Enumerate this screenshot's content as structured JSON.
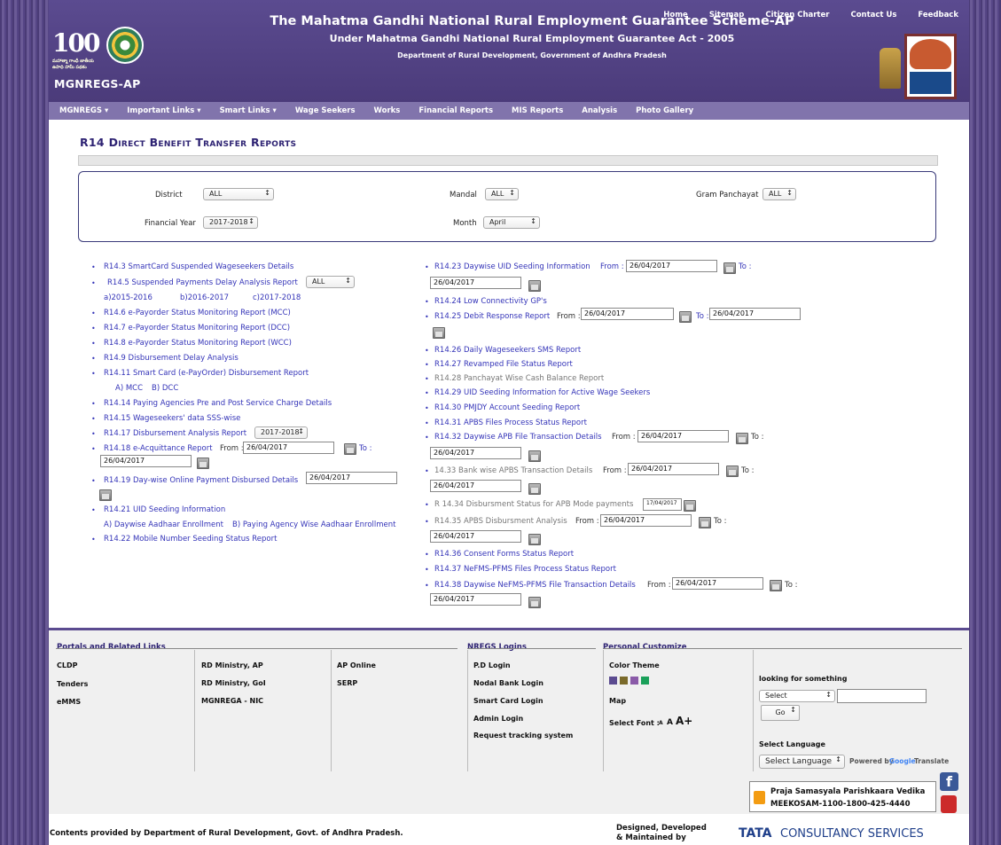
{
  "header": {
    "top_links": [
      "Home",
      "Sitemap",
      "Citizen Charter",
      "Contact Us",
      "Feedback"
    ],
    "logo_text": "100",
    "logo_subtext": "మహాత్మా గాంధీ జాతీయ ఉపాధి హామీ పథకం",
    "brand": "MGNREGS-AP",
    "title1": "The Mahatma Gandhi National Rural Employment Guarantee Scheme-AP",
    "title2": "Under Mahatma Gandhi National Rural Employment Guarantee Act - 2005",
    "title3": "Department of Rural Development, Government of Andhra Pradesh"
  },
  "nav": [
    "MGNREGS ▾",
    "Important Links ▾",
    "Smart Links ▾",
    "Wage Seekers",
    "Works",
    "Financial Reports",
    "MIS Reports",
    "Analysis",
    "Photo Gallery"
  ],
  "page": {
    "title": "R14 Direct Benefit Transfer Reports"
  },
  "filters": {
    "district_label": "District",
    "district_value": "ALL",
    "mandal_label": "Mandal",
    "mandal_value": "ALL",
    "gp_label": "Gram Panchayat",
    "gp_value": "ALL",
    "fy_label": "Financial Year",
    "fy_value": "2017-2018",
    "month_label": "Month",
    "month_value": "April"
  },
  "left": {
    "r143": "R14.3 SmartCard Suspended Wageseekers Details",
    "r145": "R14.5 Suspended Payments Delay Analysis Report",
    "r145_sel": "ALL",
    "r145_a": "a)2015-2016",
    "r145_b": "b)2016-2017",
    "r145_c": "c)2017-2018",
    "r146": "R14.6 e-Payorder Status Monitoring Report (MCC)",
    "r147": "R14.7 e-Payorder Status Monitoring Report (DCC)",
    "r148": "R14.8 e-Payorder Status Monitoring Report (WCC)",
    "r149": "R14.9 Disbursement Delay Analysis",
    "r1411": "R14.11 Smart Card (e-PayOrder) Disbursement Report",
    "r1411_a": "A) MCC",
    "r1411_b": "B) DCC",
    "r1414": "R14.14 Paying Agencies Pre and Post Service Charge Details",
    "r1415": "R14.15 Wageseekers' data SSS-wise",
    "r1417": "R14.17 Disbursement Analysis Report",
    "r1417_sel": "2017-2018",
    "r1418": "R14.18 e-Acquittance Report",
    "r1419": "R14.19 Day-wise Online Payment Disbursed Details",
    "r1421": "R14.21 UID Seeding Information",
    "r1421_a": "A) Daywise Aadhaar Enrollment",
    "r1421_b": "B) Paying Agency Wise Aadhaar Enrollment",
    "r1422": "R14.22 Mobile Number Seeding Status Report"
  },
  "right": {
    "r1423": "R14.23 Daywise UID Seeding Information",
    "r1424": "R14.24 Low Connectivity GP's",
    "r1425": "R14.25 Debit Response Report",
    "r1426": "R14.26 Daily Wageseekers SMS Report",
    "r1427": "R14.27 Revamped File Status Report",
    "r1428": "R14.28 Panchayat Wise Cash Balance Report",
    "r1429": "R14.29 UID Seeding Information for Active Wage Seekers",
    "r1430": "R14.30 PMJDY Account Seeding Report",
    "r1431": "R14.31 APBS Files Process Status Report",
    "r1432": "R14.32 Daywise APB File Transaction Details",
    "r1433": "14.33 Bank wise APBS Transaction Details",
    "r1434": "R 14.34 Disbursment Status for APB Mode payments",
    "r1434_date": "17/04/2017",
    "r1435": "R14.35 APBS Disbursment Analysis",
    "r1436": "R14.36 Consent Forms Status Report",
    "r1437": "R14.37 NeFMS-PFMS Files Process Status Report",
    "r1438": "R14.38 Daywise NeFMS-PFMS File Transaction Details"
  },
  "common": {
    "from": "From :",
    "to": "To :",
    "date": "26/04/2017"
  },
  "footer": {
    "portals_heading": "Portals and Related Links",
    "col1": [
      "CLDP",
      "Tenders",
      "eMMS"
    ],
    "col2": [
      "RD Ministry, AP",
      "RD Ministry, GoI",
      "MGNREGA - NIC"
    ],
    "col3": [
      "AP Online",
      "SERP"
    ],
    "nregs_heading": "NREGS Logins",
    "nregs": [
      "P.D Login",
      "Nodal Bank Login",
      "Smart Card Login",
      "Admin Login",
      "Request tracking system"
    ],
    "personal_heading": "Personal Customize",
    "color_theme": "Color Theme",
    "swatches": [
      "#5b4b90",
      "#7a6a2a",
      "#8a5aa8",
      "#1aa05a"
    ],
    "map": "Map",
    "select_font": "Select Font :",
    "font_sizes": [
      "A",
      "A",
      "A+"
    ],
    "looking": "looking for something",
    "looking_select": "Select",
    "go": "Go",
    "select_language_heading": "Select Language",
    "select_language": "Select Language",
    "powered": "Powered by",
    "google": "Google",
    "translate": "Translate",
    "praja1": "Praja Samasyala Parishkaara Vedika",
    "praja2": "MEEKOSAM-1100-1800-425-4440",
    "contents": "Contents provided by Department of Rural Development, Govt. of Andhra Pradesh.",
    "designed": "Designed, Developed & Maintained by",
    "tcs1": "TATA",
    "tcs2": "CONSULTANCY SERVICES"
  }
}
